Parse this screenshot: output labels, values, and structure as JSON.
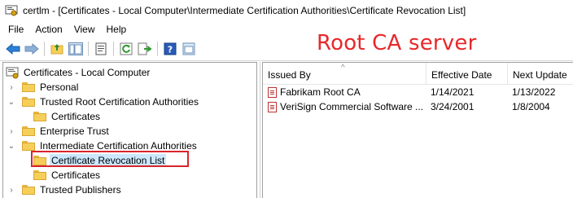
{
  "window": {
    "title": "certlm - [Certificates - Local Computer\\Intermediate Certification Authorities\\Certificate Revocation List]"
  },
  "menu": [
    "File",
    "Action",
    "View",
    "Help"
  ],
  "toolbar_icons": [
    "back-arrow-icon",
    "forward-arrow-icon",
    "up-folder-icon",
    "show-hide-tree-icon",
    "properties-icon",
    "refresh-icon",
    "export-list-icon",
    "help-icon",
    "mmc-window-icon"
  ],
  "annotation": {
    "text": "Root CA server",
    "color": "#e8282a"
  },
  "tree": {
    "root": "Certificates - Local Computer",
    "items": [
      {
        "label": "Personal",
        "level": 1,
        "expander": "collapsed"
      },
      {
        "label": "Trusted Root Certification Authorities",
        "level": 1,
        "expander": "expanded"
      },
      {
        "label": "Certificates",
        "level": 2,
        "expander": "none"
      },
      {
        "label": "Enterprise Trust",
        "level": 1,
        "expander": "collapsed"
      },
      {
        "label": "Intermediate Certification Authorities",
        "level": 1,
        "expander": "expanded"
      },
      {
        "label": "Certificate Revocation List",
        "level": 2,
        "expander": "none",
        "selected": true
      },
      {
        "label": "Certificates",
        "level": 2,
        "expander": "none"
      },
      {
        "label": "Trusted Publishers",
        "level": 1,
        "expander": "collapsed"
      }
    ]
  },
  "list": {
    "columns": [
      "Issued By",
      "Effective Date",
      "Next Update"
    ],
    "rows": [
      [
        "Fabrikam Root CA",
        "1/14/2021",
        "1/13/2022"
      ],
      [
        "VeriSign Commercial Software ...",
        "3/24/2001",
        "1/8/2004"
      ]
    ]
  },
  "colors": {
    "selection": "#cce8ff",
    "highlight_border": "#d9252b",
    "folder": "#f5cf5a"
  }
}
